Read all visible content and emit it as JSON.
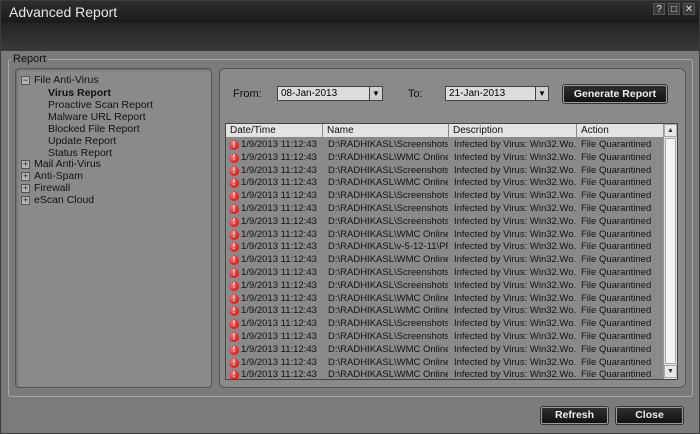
{
  "window": {
    "title": "Advanced Report",
    "buttons": [
      "?",
      "□",
      "✕"
    ]
  },
  "report_label": "Report",
  "tree": {
    "root_file_av": "File Anti-Virus",
    "children": [
      "Virus Report",
      "Proactive Scan Report",
      "Malware URL Report",
      "Blocked File Report",
      "Update Report",
      "Status Report"
    ],
    "others": [
      "Mail Anti-Virus",
      "Anti-Spam",
      "Firewall",
      "eScan Cloud"
    ]
  },
  "filters": {
    "from_label": "From:",
    "from_value": "08-Jan-2013",
    "to_label": "To:",
    "to_value": "21-Jan-2013",
    "generate_label": "Generate Report"
  },
  "table": {
    "columns": [
      "Date/Time",
      "Name",
      "Description",
      "Action"
    ],
    "rows": [
      [
        "1/9/2013 11:12:43",
        "D:\\RADHIKASL\\Screenshots\\e...",
        "Infected by Virus: Win32.Wo...",
        "File Quarantined"
      ],
      [
        "1/9/2013 11:12:43",
        "D:\\RADHIKASL\\WMC Online ...",
        "Infected by Virus: Win32.Wo...",
        "File Quarantined"
      ],
      [
        "1/9/2013 11:12:43",
        "D:\\RADHIKASL\\Screenshots\\e...",
        "Infected by Virus: Win32.Wo...",
        "File Quarantined"
      ],
      [
        "1/9/2013 11:12:43",
        "D:\\RADHIKASL\\WMC Online ...",
        "Infected by Virus: Win32.Wo...",
        "File Quarantined"
      ],
      [
        "1/9/2013 11:12:43",
        "D:\\RADHIKASL\\Screenshots\\e...",
        "Infected by Virus: Win32.Wo...",
        "File Quarantined"
      ],
      [
        "1/9/2013 11:12:43",
        "D:\\RADHIKASL\\Screenshots\\...",
        "Infected by Virus: Win32.Wo...",
        "File Quarantined"
      ],
      [
        "1/9/2013 11:12:43",
        "D:\\RADHIKASL\\Screenshots\\e...",
        "Infected by Virus: Win32.Wo...",
        "File Quarantined"
      ],
      [
        "1/9/2013 11:12:43",
        "D:\\RADHIKASL\\WMC Online ...",
        "Infected by Virus: Win32.Wo...",
        "File Quarantined"
      ],
      [
        "1/9/2013 11:12:43",
        "D:\\RADHIKASL\\v-5-12-11\\PRA...",
        "Infected by Virus: Win32.Wo...",
        "File Quarantined"
      ],
      [
        "1/9/2013 11:12:43",
        "D:\\RADHIKASL\\WMC Online ...",
        "Infected by Virus: Win32.Wo...",
        "File Quarantined"
      ],
      [
        "1/9/2013 11:12:43",
        "D:\\RADHIKASL\\Screenshots\\e...",
        "Infected by Virus: Win32.Wo...",
        "File Quarantined"
      ],
      [
        "1/9/2013 11:12:43",
        "D:\\RADHIKASL\\Screenshots\\e...",
        "Infected by Virus: Win32.Wo...",
        "File Quarantined"
      ],
      [
        "1/9/2013 11:12:43",
        "D:\\RADHIKASL\\WMC Online ...",
        "Infected by Virus: Win32.Wo...",
        "File Quarantined"
      ],
      [
        "1/9/2013 11:12:43",
        "D:\\RADHIKASL\\WMC Online ...",
        "Infected by Virus: Win32.Wo...",
        "File Quarantined"
      ],
      [
        "1/9/2013 11:12:43",
        "D:\\RADHIKASL\\Screenshots\\e...",
        "Infected by Virus: Win32.Wo...",
        "File Quarantined"
      ],
      [
        "1/9/2013 11:12:43",
        "D:\\RADHIKASL\\Screenshots\\e...",
        "Infected by Virus: Win32.Wo...",
        "File Quarantined"
      ],
      [
        "1/9/2013 11:12:43",
        "D:\\RADHIKASL\\WMC Online ...",
        "Infected by Virus: Win32.Wo...",
        "File Quarantined"
      ],
      [
        "1/9/2013 11:12:43",
        "D:\\RADHIKASL\\WMC Online ...",
        "Infected by Virus: Win32.Wo...",
        "File Quarantined"
      ],
      [
        "1/9/2013 11:12:43",
        "D:\\RADHIKASL\\WMC Online ...",
        "Infected by Virus: Win32.Wo...",
        "File Quarantined"
      ]
    ]
  },
  "footer": {
    "refresh_label": "Refresh",
    "close_label": "Close"
  }
}
